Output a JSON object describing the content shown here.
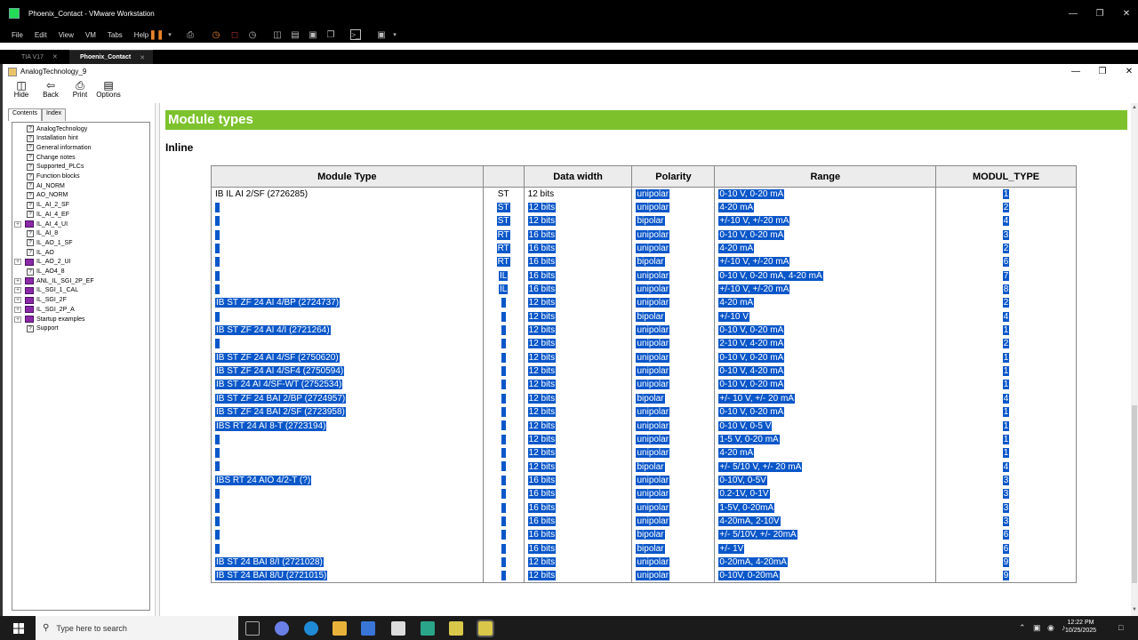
{
  "window": {
    "title": "Phoenix_Contact - VMware Workstation"
  },
  "menu": [
    "File",
    "Edit",
    "View",
    "VM",
    "Tabs",
    "Help"
  ],
  "vm_tabs": [
    {
      "label": "TIA V17"
    },
    {
      "label": "Phoenix_Contact"
    }
  ],
  "help": {
    "title": "AnalogTechnology_9",
    "tools": {
      "hide": "Hide",
      "back": "Back",
      "print": "Print",
      "options": "Options"
    },
    "nav_tabs": {
      "contents": "Contents",
      "index": "Index"
    },
    "tree": [
      {
        "label": "AnalogTechnology",
        "type": "page",
        "exp": false
      },
      {
        "label": "Installation hint",
        "type": "page",
        "exp": false
      },
      {
        "label": "General information",
        "type": "page",
        "exp": false
      },
      {
        "label": "Change notes",
        "type": "page",
        "exp": false
      },
      {
        "label": "Supported_PLCs",
        "type": "page",
        "exp": false
      },
      {
        "label": "Function blocks",
        "type": "page",
        "exp": false
      },
      {
        "label": "AI_NORM",
        "type": "page",
        "exp": false
      },
      {
        "label": "AO_NORM",
        "type": "page",
        "exp": false
      },
      {
        "label": "IL_AI_2_SF",
        "type": "page",
        "exp": false
      },
      {
        "label": "IL_AI_4_EF",
        "type": "page",
        "exp": false
      },
      {
        "label": "IL_AI_4_UI",
        "type": "book",
        "exp": true
      },
      {
        "label": "IL_AI_8",
        "type": "page",
        "exp": false
      },
      {
        "label": "IL_AO_1_SF",
        "type": "page",
        "exp": false
      },
      {
        "label": "IL_AO",
        "type": "page",
        "exp": false
      },
      {
        "label": "IL_AO_2_UI",
        "type": "book",
        "exp": true
      },
      {
        "label": "IL_AO4_8",
        "type": "page",
        "exp": false
      },
      {
        "label": "ANL_IL_SGI_2P_EF",
        "type": "book",
        "exp": true
      },
      {
        "label": "IL_SGI_1_CAL",
        "type": "book",
        "exp": true
      },
      {
        "label": "IL_SGI_2F",
        "type": "book",
        "exp": true
      },
      {
        "label": "IL_SGI_2P_A",
        "type": "book",
        "exp": true
      },
      {
        "label": "Startup examples",
        "type": "book",
        "exp": true
      },
      {
        "label": "Support",
        "type": "page",
        "exp": false
      }
    ]
  },
  "content": {
    "banner": "Module types",
    "section": "Inline",
    "table": {
      "headers": [
        "Module Type",
        "",
        "Data width",
        "Polarity",
        "Range",
        "MODUL_TYPE"
      ],
      "rows": [
        [
          "IB IL AI 2/SF (2726285)",
          "ST",
          "12 bits",
          "unipolar",
          "0-10 V, 0-20 mA",
          "1"
        ],
        [
          "",
          "ST",
          "12 bits",
          "unipolar",
          "4-20 mA",
          "2"
        ],
        [
          "",
          "ST",
          "12 bits",
          "bipolar",
          "+/-10 V, +/-20 mA",
          "4"
        ],
        [
          "",
          "RT",
          "16 bits",
          "unipolar",
          "0-10 V, 0-20 mA",
          "3"
        ],
        [
          "",
          "RT",
          "16 bits",
          "unipolar",
          "4-20 mA",
          "2"
        ],
        [
          "",
          "RT",
          "16 bits",
          "bipolar",
          "+/-10 V, +/-20 mA",
          "6"
        ],
        [
          "",
          "IL",
          "16 bits",
          "unipolar",
          "0-10 V, 0-20 mA, 4-20 mA",
          "7"
        ],
        [
          "",
          "IL",
          "16 bits",
          "unipolar",
          "+/-10 V, +/-20 mA",
          "8"
        ],
        [
          "IB ST ZF 24 AI 4/BP (2724737)",
          "",
          "12 bits",
          "unipolar",
          "4-20 mA",
          "2"
        ],
        [
          "",
          "",
          "12 bits",
          "bipolar",
          "+/-10 V",
          "4"
        ],
        [
          "IB ST ZF 24 AI 4/I (2721264)",
          "",
          "12 bits",
          "unipolar",
          "0-10 V, 0-20 mA",
          "1"
        ],
        [
          "",
          "",
          "12 bits",
          "unipolar",
          "2-10 V, 4-20 mA",
          "2"
        ],
        [
          "IB ST ZF 24 AI 4/SF (2750620)",
          "",
          "12 bits",
          "unipolar",
          "0-10 V, 0-20 mA",
          "1"
        ],
        [
          "IB ST ZF 24 AI 4/SF4 (2750594)",
          "",
          "12 bits",
          "unipolar",
          "0-10 V, 4-20 mA",
          "1"
        ],
        [
          "IB ST 24 AI 4/SF-WT (2752534)",
          "",
          "12 bits",
          "unipolar",
          "0-10 V, 0-20 mA",
          "1"
        ],
        [
          "IB ST ZF 24 BAI 2/BP (2724957)",
          "",
          "12 bits",
          "bipolar",
          "+/- 10 V, +/- 20 mA",
          "4"
        ],
        [
          "IB ST ZF 24 BAI 2/SF (2723958)",
          "",
          "12 bits",
          "unipolar",
          "0-10 V, 0-20 mA",
          "1"
        ],
        [
          "IBS RT 24 AI 8-T (2723194)",
          "",
          "12 bits",
          "unipolar",
          "0-10 V, 0-5 V",
          "1"
        ],
        [
          "",
          "",
          "12 bits",
          "unipolar",
          "1-5 V, 0-20 mA",
          "1"
        ],
        [
          "",
          "",
          "12 bits",
          "unipolar",
          "4-20 mA",
          "1"
        ],
        [
          "",
          "",
          "12 bits",
          "bipolar",
          "+/- 5/10 V, +/- 20 mA",
          "4"
        ],
        [
          "IBS RT 24 AIO 4/2-T (?)",
          "",
          "16 bits",
          "unipolar",
          "0-10V, 0-5V",
          "3"
        ],
        [
          "",
          "",
          "16 bits",
          "unipolar",
          "0.2-1V, 0-1V",
          "3"
        ],
        [
          "",
          "",
          "16 bits",
          "unipolar",
          "1-5V, 0-20mA",
          "3"
        ],
        [
          "",
          "",
          "16 bits",
          "unipolar",
          "4-20mA, 2-10V",
          "3"
        ],
        [
          "",
          "",
          "16 bits",
          "bipolar",
          "+/- 5/10V, +/- 20mA",
          "6"
        ],
        [
          "",
          "",
          "16 bits",
          "bipolar",
          "+/- 1V",
          "6"
        ],
        [
          "IB ST 24 BAI 8/I (2721028)",
          "",
          "12 bits",
          "unipolar",
          "0-20mA, 4-20mA",
          "9"
        ],
        [
          "IB ST 24 BAI 8/U (2721015)",
          "",
          "12 bits",
          "unipolar",
          "0-10V, 0-20mA",
          "9"
        ]
      ]
    }
  },
  "taskbar": {
    "search_placeholder": "Type here to search",
    "time": "12:22 PM",
    "date": "10/25/2025"
  }
}
